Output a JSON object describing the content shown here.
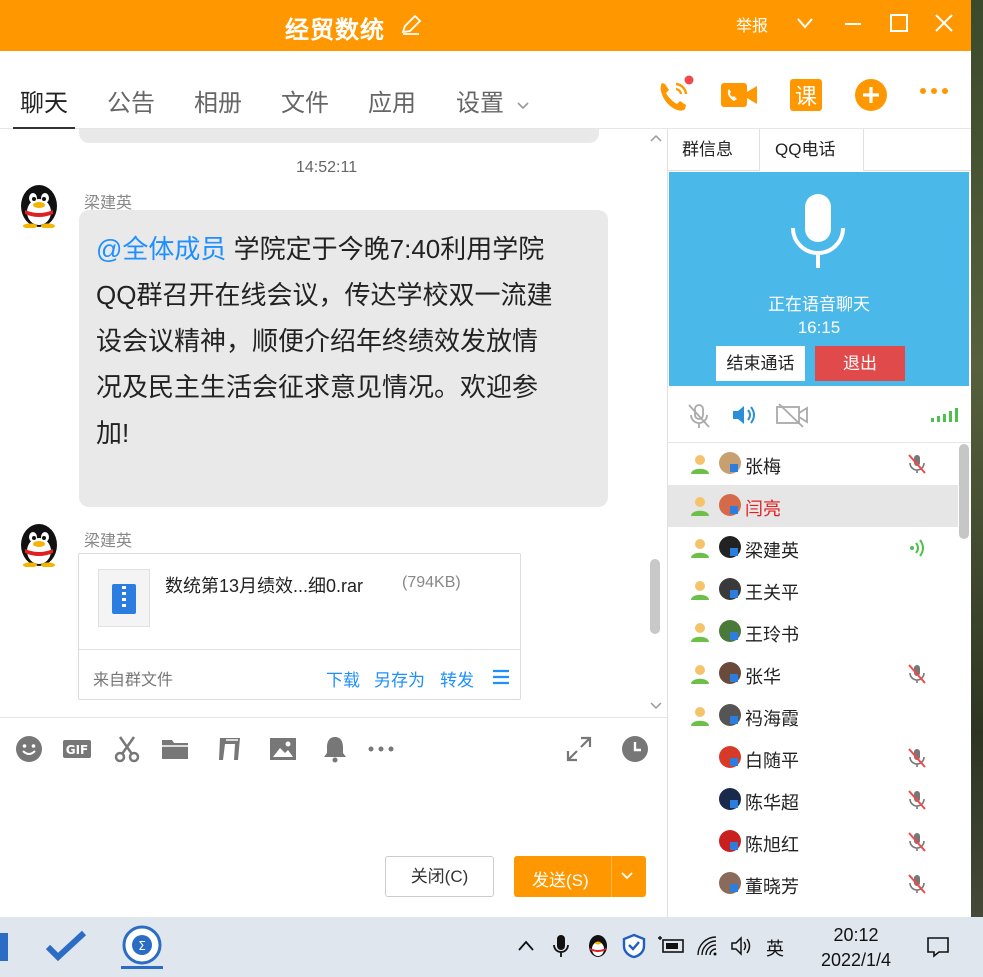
{
  "window": {
    "title": "经贸数统",
    "report_label": "举报",
    "accent_color": "#ff9800"
  },
  "tabs": {
    "chat": "聊天",
    "notice": "公告",
    "album": "相册",
    "files": "文件",
    "apps": "应用",
    "settings": "设置"
  },
  "chat": {
    "timestamp": "14:52:11",
    "messages": [
      {
        "sender": "梁建英",
        "mention": "@全体成员",
        "lines": [
          " 学院定于今晚7:40利用学院",
          "QQ群召开在线会议，传达学校双一流建",
          "设会议精神，顺便介绍年终绩效发放情",
          "况及民主生活会征求意见情况。欢迎参",
          "加!"
        ]
      },
      {
        "sender": "梁建英",
        "file_name": "数统第13月绩效...细0.rar",
        "file_size": "(794KB)",
        "file_source": "来自群文件",
        "action_download": "下载",
        "action_save_as": "另存为",
        "action_forward": "转发"
      }
    ]
  },
  "composer": {
    "close_label": "关闭(C)",
    "send_label": "发送(S)"
  },
  "right_panel": {
    "tab_group_info": "群信息",
    "tab_qq_call": "QQ电话",
    "call_status": "正在语音聊天",
    "call_duration": "16:15",
    "end_call_label": "结束通话",
    "quit_label": "退出",
    "members": [
      {
        "name": "张梅",
        "muted": true,
        "speaking": false,
        "highlight": false,
        "red": false,
        "person": true
      },
      {
        "name": "闫亮",
        "muted": false,
        "speaking": false,
        "highlight": true,
        "red": true,
        "person": true
      },
      {
        "name": "梁建英",
        "muted": false,
        "speaking": true,
        "highlight": false,
        "red": false,
        "person": true
      },
      {
        "name": "王关平",
        "muted": false,
        "speaking": false,
        "highlight": false,
        "red": false,
        "person": true
      },
      {
        "name": "王玲书",
        "muted": false,
        "speaking": false,
        "highlight": false,
        "red": false,
        "person": true
      },
      {
        "name": "张华",
        "muted": true,
        "speaking": false,
        "highlight": false,
        "red": false,
        "person": true
      },
      {
        "name": "祃海霞",
        "muted": false,
        "speaking": false,
        "highlight": false,
        "red": false,
        "person": true
      },
      {
        "name": "白随平",
        "muted": true,
        "speaking": false,
        "highlight": false,
        "red": false,
        "person": false
      },
      {
        "name": "陈华超",
        "muted": true,
        "speaking": false,
        "highlight": false,
        "red": false,
        "person": false
      },
      {
        "name": "陈旭红",
        "muted": true,
        "speaking": false,
        "highlight": false,
        "red": false,
        "person": false
      },
      {
        "name": "董晓芳",
        "muted": true,
        "speaking": false,
        "highlight": false,
        "red": false,
        "person": false
      }
    ]
  },
  "taskbar": {
    "ime": "英",
    "time": "20:12",
    "date": "2022/1/4"
  }
}
